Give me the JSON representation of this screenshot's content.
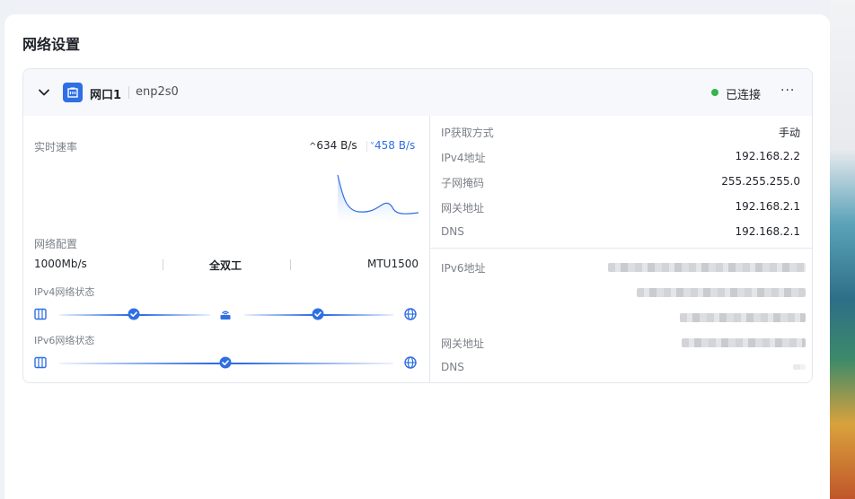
{
  "page_title": "网络设置",
  "interface": {
    "name": "网口1",
    "device": "enp2s0",
    "status": "已连接",
    "status_color": "#36b34a",
    "more_label": "···"
  },
  "speed": {
    "label": "实时速率",
    "upload": "634 B/s",
    "download": "458 B/s"
  },
  "config": {
    "label": "网络配置",
    "speed": "1000Mb/s",
    "duplex": "全双工",
    "mtu": "MTU1500"
  },
  "ipv4_status": {
    "label": "IPv4网络状态"
  },
  "ipv6_status": {
    "label": "IPv6网络状态"
  },
  "ipv4": {
    "method_label": "IP获取方式",
    "method": "手动",
    "address_label": "IPv4地址",
    "address": "192.168.2.2",
    "mask_label": "子网掩码",
    "mask": "255.255.255.0",
    "gateway_label": "网关地址",
    "gateway": "192.168.2.1",
    "dns_label": "DNS",
    "dns": "192.168.2.1"
  },
  "ipv6": {
    "address_label": "IPv6地址",
    "gateway_label": "网关地址",
    "dns_label": "DNS"
  },
  "icons": {
    "collapse": "chevron-down-icon",
    "port": "ethernet-port-icon",
    "device": "device-icon",
    "router": "router-icon",
    "globe": "globe-icon",
    "check": "check-circle-icon"
  },
  "accent_color": "#2f6fe4"
}
